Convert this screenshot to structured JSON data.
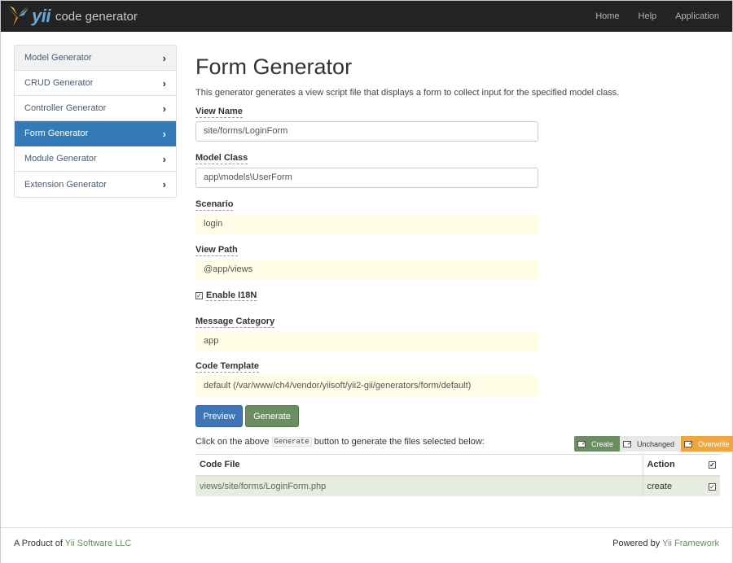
{
  "navbar": {
    "brand_yii": "yii",
    "brand_text": "code generator",
    "links": [
      "Home",
      "Help",
      "Application"
    ]
  },
  "sidebar": {
    "items": [
      {
        "label": "Model Generator"
      },
      {
        "label": "CRUD Generator"
      },
      {
        "label": "Controller Generator"
      },
      {
        "label": "Form Generator",
        "active": true
      },
      {
        "label": "Module Generator"
      },
      {
        "label": "Extension Generator"
      }
    ]
  },
  "main": {
    "title": "Form Generator",
    "description": "This generator generates a view script file that displays a form to collect input for the specified model class.",
    "fields": {
      "view_name": {
        "label": "View Name",
        "value": "site/forms/LoginForm"
      },
      "model_class": {
        "label": "Model Class",
        "value": "app\\models\\UserForm"
      },
      "scenario": {
        "label": "Scenario",
        "value": "login"
      },
      "view_path": {
        "label": "View Path",
        "value": "@app/views"
      },
      "enable_i18n": {
        "label": "Enable I18N",
        "checked": true
      },
      "message_category": {
        "label": "Message Category",
        "value": "app"
      },
      "code_template": {
        "label": "Code Template",
        "value": "default (/var/www/ch4/vendor/yiisoft/yii2-gii/generators/form/default)"
      }
    },
    "buttons": {
      "preview": "Preview",
      "generate": "Generate"
    },
    "hint": {
      "before": "Click on the above",
      "code": "Generate",
      "after": "button to generate the files selected below:"
    },
    "legend": {
      "create": "Create",
      "unchanged": "Unchanged",
      "overwrite": "Overwrite"
    },
    "table": {
      "headers": {
        "file": "Code File",
        "action": "Action"
      },
      "rows": [
        {
          "file": "views/site/forms/LoginForm.php",
          "action": "create",
          "checked": true
        }
      ]
    }
  },
  "footer": {
    "left_prefix": "A Product of",
    "left_link": "Yii Software LLC",
    "right_prefix": "Powered by",
    "right_link": "Yii Framework"
  },
  "colors": {
    "primary": "#337ab7",
    "success": "#6a8e62",
    "warning": "#f0a63c",
    "sticky_input": "#fffde6"
  }
}
